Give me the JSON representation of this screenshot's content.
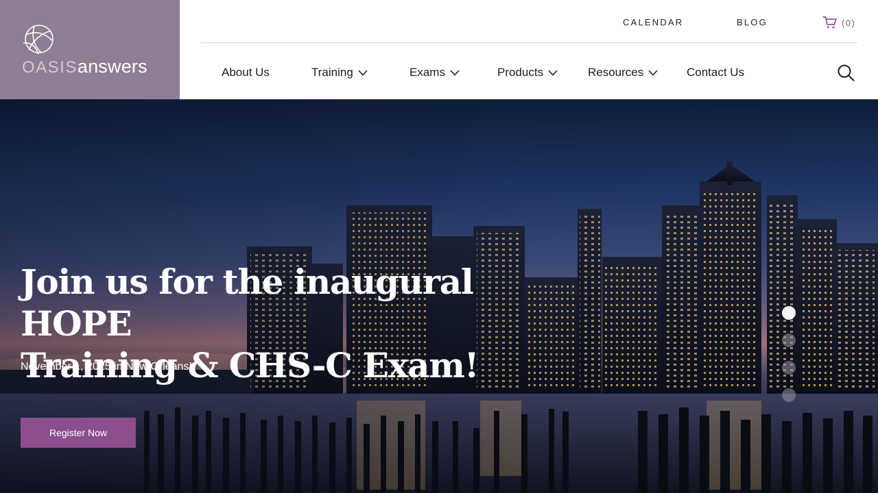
{
  "logo": {
    "oasis": "OASIS",
    "answers": "answers"
  },
  "topbar": {
    "calendar": "CALENDAR",
    "blog": "BLOG",
    "cart_count": "(0)"
  },
  "nav": {
    "items": [
      {
        "label": "About Us",
        "dropdown": false
      },
      {
        "label": "Training",
        "dropdown": true
      },
      {
        "label": "Exams",
        "dropdown": true
      },
      {
        "label": "Products",
        "dropdown": true
      },
      {
        "label": "Resources",
        "dropdown": true
      },
      {
        "label": "Contact Us",
        "dropdown": false
      }
    ]
  },
  "hero": {
    "title_line1": "Join us for the inaugural HOPE",
    "title_line2": "Training & CHS-C Exam!",
    "subtitle": "November 1, 2025 in New Orleans!",
    "button": "Register Now",
    "slides": 4,
    "active_slide": 1
  },
  "colors": {
    "brand": "#8b4e8e",
    "logo_panel": "#8e7e93"
  },
  "icons": [
    "logo-mark-icon",
    "cart-icon",
    "chevron-down-icon",
    "search-icon"
  ]
}
